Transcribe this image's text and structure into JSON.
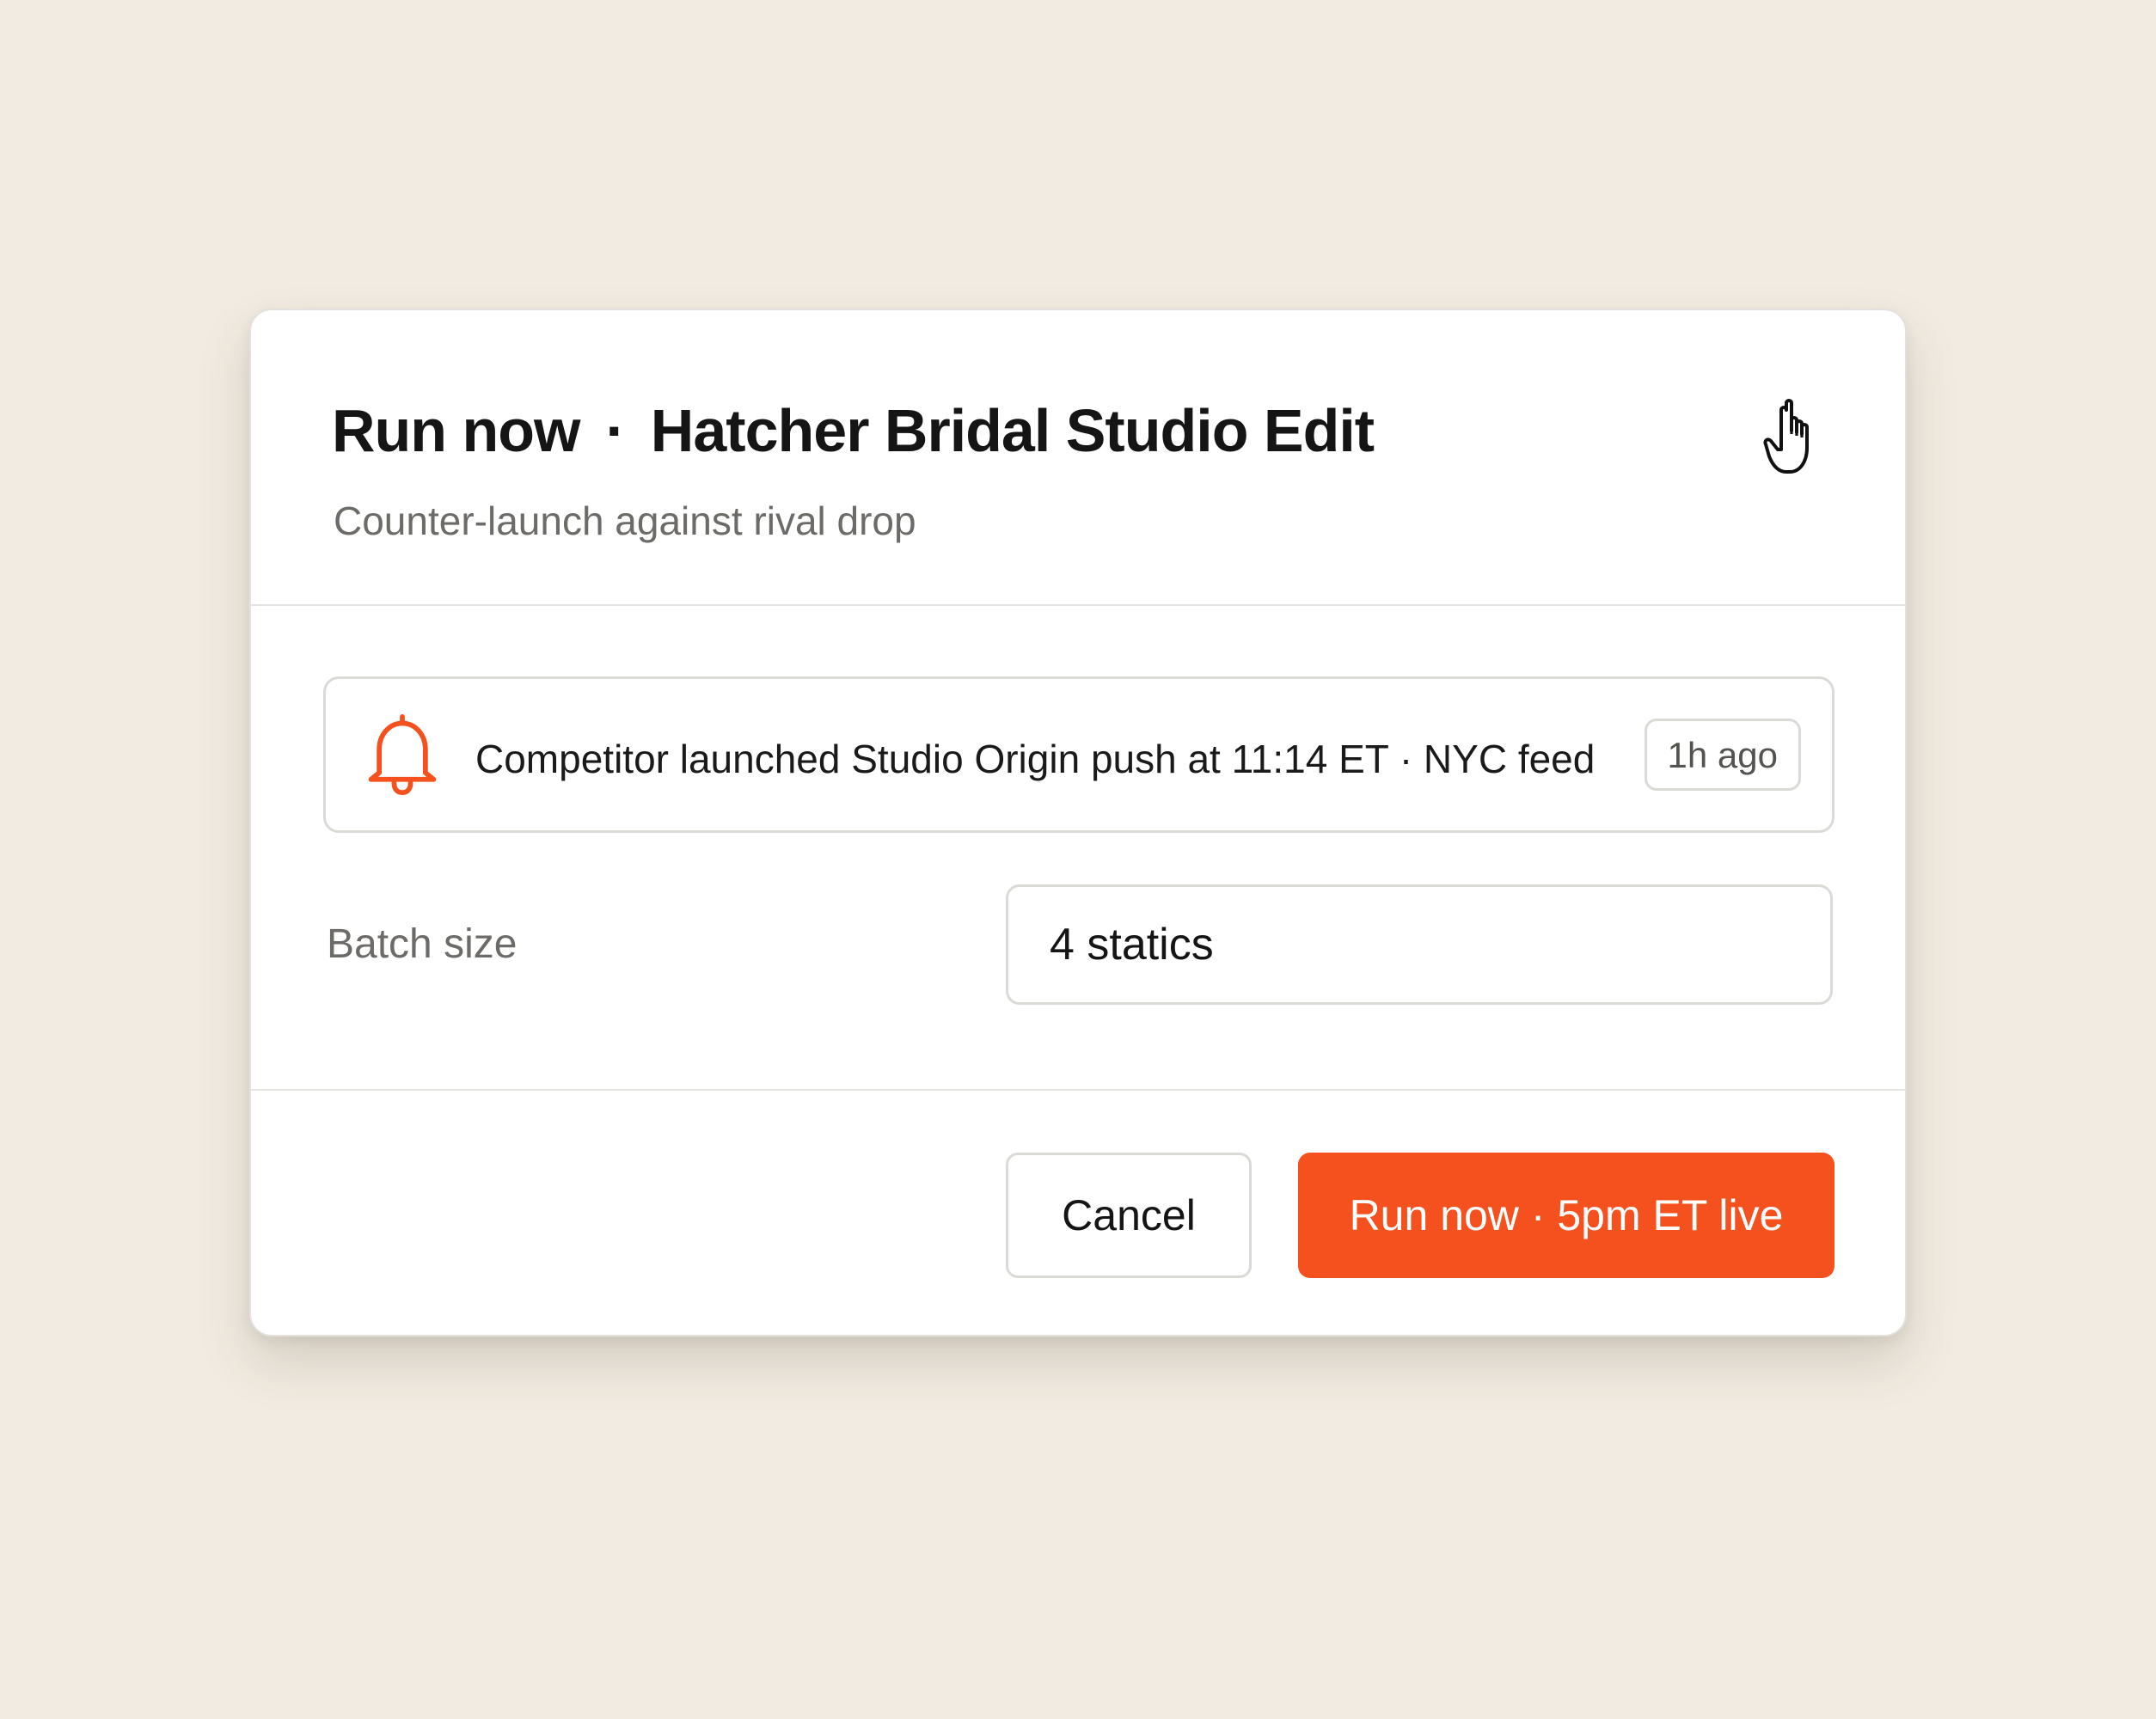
{
  "dialog": {
    "title_action": "Run now",
    "title_separator": "·",
    "title_name": "Hatcher Bridal Studio Edit",
    "subtitle": "Counter-launch against rival drop"
  },
  "alert": {
    "icon": "bell-icon",
    "message": "Competitor launched Studio Origin push at 11:14 ET · NYC feed",
    "time_badge": "1h ago"
  },
  "form": {
    "batch_size_label": "Batch size",
    "batch_size_value": "4 statics"
  },
  "footer": {
    "cancel_label": "Cancel",
    "run_label": "Run now · 5pm ET live"
  },
  "colors": {
    "accent": "#f4511e",
    "background": "#f1ebe1"
  }
}
